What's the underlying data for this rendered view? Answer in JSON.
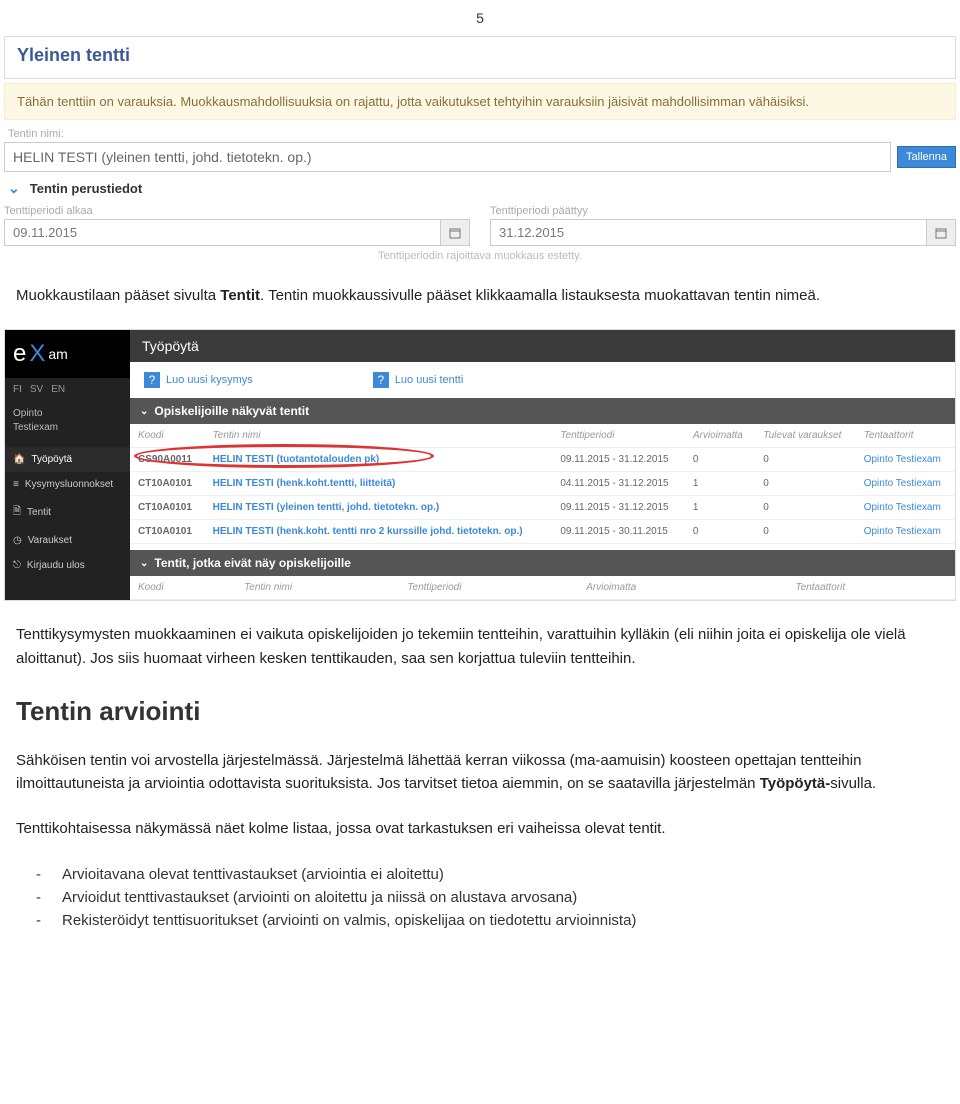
{
  "pageNumber": "5",
  "banner": {
    "title": "Yleinen tentti",
    "warning": "Tähän tenttiin on varauksia. Muokkausmahdollisuuksia on rajattu, jotta vaikutukset tehtyihin varauksiin jäisivät mahdollisimman vähäisiksi."
  },
  "form": {
    "nameLabel": "Tentin nimi:",
    "nameValue": "HELIN TESTI (yleinen tentti, johd. tietotekn. op.)",
    "saveLabel": "Tallenna",
    "accordionTitle": "Tentin perustiedot",
    "periodStartLabel": "Tenttiperiodi alkaa",
    "periodStartValue": "09.11.2015",
    "periodEndLabel": "Tenttiperiodi päättyy",
    "periodEndValue": "31.12.2015",
    "restrictNote": "Tenttiperiodin rajoittava muokkaus estetty."
  },
  "para1_a": "Muokkaustilaan pääset sivulta ",
  "para1_bold": "Tentit",
  "para1_b": ". Tentin muokkaussivulle pääset klikkaamalla listauksesta muokattavan tentin nimeä.",
  "dash": {
    "title": "Työpöytä",
    "lang": [
      "FI",
      "SV",
      "EN"
    ],
    "userLine1": "Opinto",
    "userLine2": "Testiexam",
    "nav": [
      {
        "label": "Työpöytä"
      },
      {
        "label": "Kysymysluonnokset"
      },
      {
        "label": "Tentit"
      },
      {
        "label": "Varaukset"
      },
      {
        "label": "Kirjaudu ulos"
      }
    ],
    "create1": "Luo uusi kysymys",
    "create2": "Luo uusi tentti",
    "sec1": "Opiskelijoille näkyvät tentit",
    "sec2": "Tentit, jotka eivät näy opiskelijoille",
    "headers": [
      "Koodi",
      "Tentin nimi",
      "Tenttiperiodi",
      "Arvioimatta",
      "Tulevat varaukset",
      "Tentaattorit"
    ],
    "rows": [
      {
        "code": "CS90A0011",
        "name": "HELIN TESTI (tuotantotalouden pk)",
        "period": "09.11.2015 - 31.12.2015",
        "pending": "0",
        "upcoming": "0",
        "examiner": "Opinto Testiexam"
      },
      {
        "code": "CT10A0101",
        "name": "HELIN TESTI (henk.koht.tentti, liitteitä)",
        "period": "04.11.2015 - 31.12.2015",
        "pending": "1",
        "upcoming": "0",
        "examiner": "Opinto Testiexam"
      },
      {
        "code": "CT10A0101",
        "name": "HELIN TESTI (yleinen tentti, johd. tietotekn. op.)",
        "period": "09.11.2015 - 31.12.2015",
        "pending": "1",
        "upcoming": "0",
        "examiner": "Opinto Testiexam"
      },
      {
        "code": "CT10A0101",
        "name": "HELIN TESTI (henk.koht. tentti nro 2 kurssille johd. tietotekn. op.)",
        "period": "09.11.2015 - 30.11.2015",
        "pending": "0",
        "upcoming": "0",
        "examiner": "Opinto Testiexam"
      }
    ]
  },
  "para2": "Tenttikysymysten muokkaaminen ei vaikuta opiskelijoiden jo tekemiin tentteihin, varattuihin kylläkin (eli niihin joita ei opiskelija ole vielä aloittanut). Jos siis huomaat virheen kesken tenttikauden, saa sen korjattua tuleviin tentteihin.",
  "h2": "Tentin arviointi",
  "para3_a": "Sähköisen tentin voi arvostella järjestelmässä. Järjestelmä lähettää kerran viikossa (ma-aamuisin) koosteen opettajan tentteihin ilmoittautuneista ja arviointia odottavista suorituksista. Jos tarvitset tietoa aiemmin, on se saatavilla järjestelmän ",
  "para3_bold": "Työpöytä-",
  "para3_b": "sivulla.",
  "para4": "Tenttikohtaisessa näkymässä näet kolme listaa, jossa ovat tarkastuksen eri vaiheissa olevat tentit.",
  "list": [
    "Arvioitavana olevat tenttivastaukset (arviointia ei aloitettu)",
    "Arvioidut tenttivastaukset (arviointi on aloitettu ja niissä on alustava arvosana)",
    "Rekisteröidyt tenttisuoritukset (arviointi on valmis, opiskelijaa on tiedotettu arvioinnista)"
  ]
}
